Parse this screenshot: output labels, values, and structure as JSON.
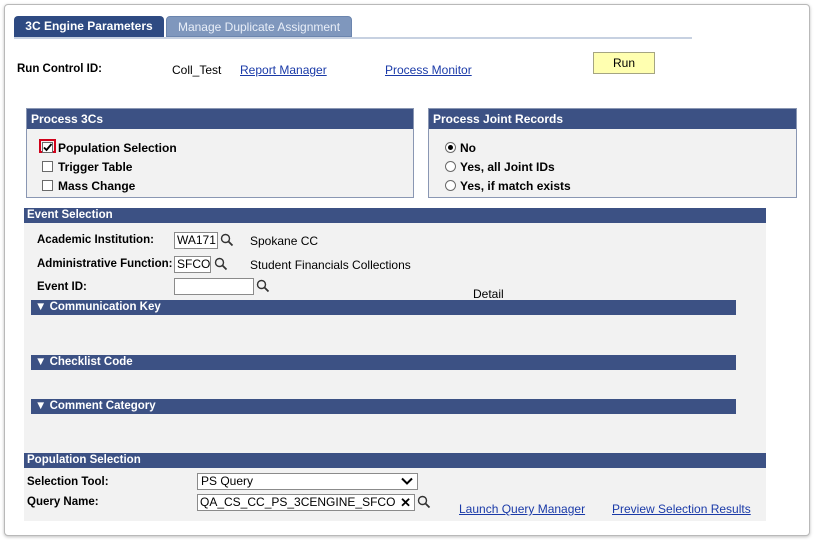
{
  "tabs": [
    {
      "label": "3C Engine Parameters",
      "active": true
    },
    {
      "label": "Manage Duplicate Assignment",
      "active": false
    }
  ],
  "run_control": {
    "label": "Run Control ID:",
    "value": "Coll_Test",
    "report_manager": "Report Manager",
    "process_monitor": "Process Monitor",
    "run_button": "Run"
  },
  "process_3cs": {
    "title": "Process 3Cs",
    "options": [
      {
        "label": "Population Selection",
        "checked": true
      },
      {
        "label": "Trigger Table",
        "checked": false
      },
      {
        "label": "Mass Change",
        "checked": false
      }
    ]
  },
  "joint_records": {
    "title": "Process Joint Records",
    "options": [
      {
        "label": "No",
        "selected": true
      },
      {
        "label": "Yes, all Joint IDs",
        "selected": false
      },
      {
        "label": "Yes, if match exists",
        "selected": false
      }
    ]
  },
  "event_selection": {
    "title": "Event Selection",
    "institution_label": "Academic Institution:",
    "institution_value": "WA171",
    "institution_desc": "Spokane CC",
    "admin_label": "Administrative Function:",
    "admin_value": "SFCO",
    "admin_desc": "Student Financials Collections",
    "event_label": "Event ID:",
    "event_value": "",
    "detail": "Detail",
    "comm_key": "Communication Key",
    "checklist_code": "Checklist Code",
    "comment_category": "Comment Category"
  },
  "population_selection": {
    "title": "Population Selection",
    "tool_label": "Selection Tool:",
    "tool_value": "PS Query",
    "query_label": "Query Name:",
    "query_value": "QA_CS_CC_PS_3CENGINE_SFCO",
    "launch_link": "Launch Query Manager",
    "preview_link": "Preview Selection Results"
  },
  "colors": {
    "header_bg": "#3c5184",
    "tab_active": "#2e4a82",
    "run_button": "#ffffb0",
    "link": "#1a3aa8",
    "highlight": "#d0021b"
  }
}
